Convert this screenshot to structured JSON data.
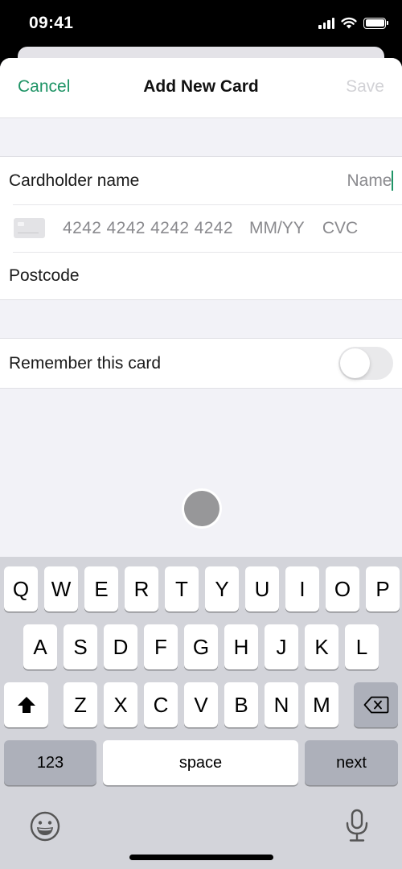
{
  "status_bar": {
    "time": "09:41"
  },
  "nav": {
    "cancel_label": "Cancel",
    "title": "Add New Card",
    "save_label": "Save"
  },
  "colors": {
    "accent": "#1f9466",
    "save_disabled": "#d2d2d6",
    "placeholder": "#8a8a8e",
    "keyboard_bg": "#d3d4da"
  },
  "form": {
    "cardholder_label": "Cardholder name",
    "cardholder_placeholder": "Name",
    "card_number_placeholder": "4242 4242 4242 4242",
    "expiry_placeholder": "MM/YY",
    "cvc_placeholder": "CVC",
    "postcode_label": "Postcode",
    "remember_label": "Remember this card",
    "remember_enabled": false
  },
  "keyboard": {
    "row1": [
      "Q",
      "W",
      "E",
      "R",
      "T",
      "Y",
      "U",
      "I",
      "O",
      "P"
    ],
    "row2": [
      "A",
      "S",
      "D",
      "F",
      "G",
      "H",
      "J",
      "K",
      "L"
    ],
    "row3": [
      "Z",
      "X",
      "C",
      "V",
      "B",
      "N",
      "M"
    ],
    "numbers_label": "123",
    "space_label": "space",
    "next_label": "next"
  }
}
